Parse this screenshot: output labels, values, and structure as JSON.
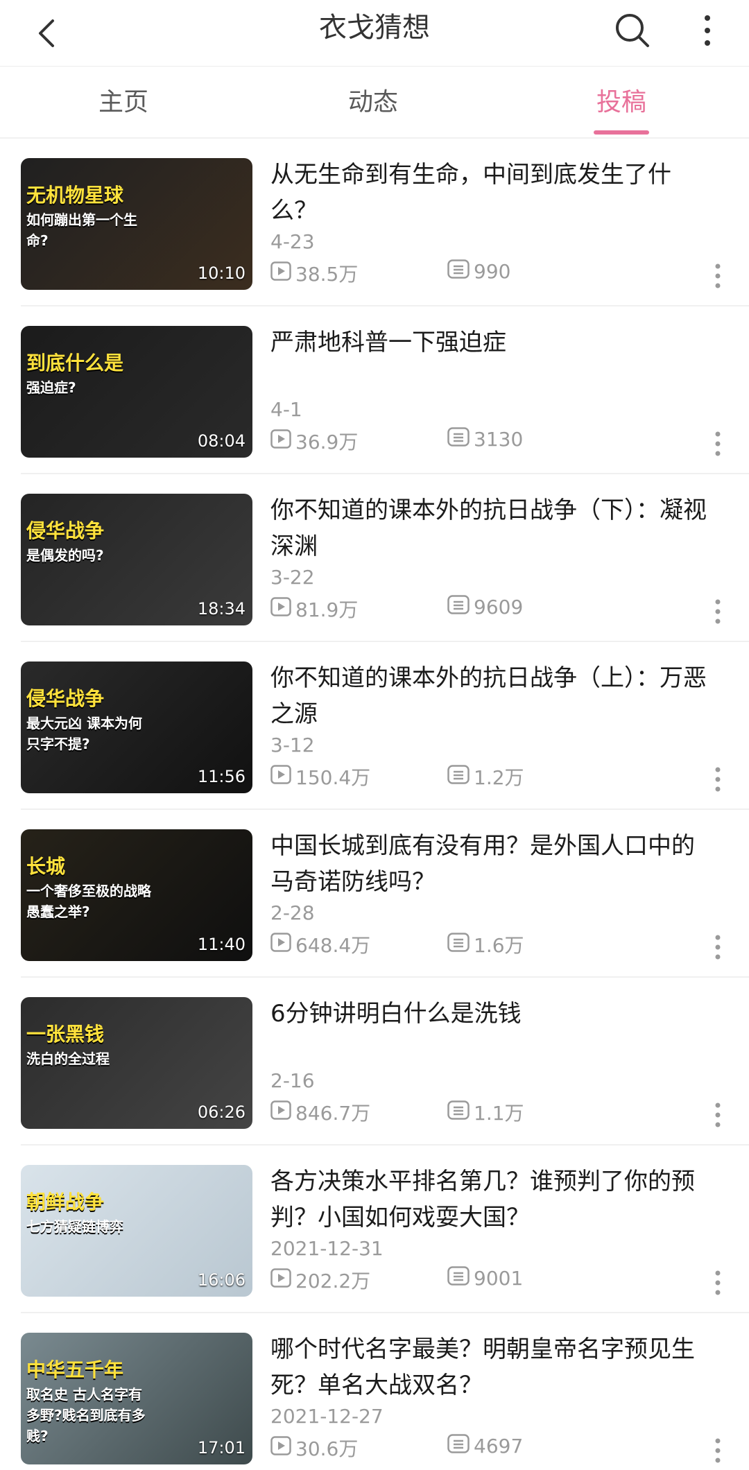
{
  "header": {
    "title": "衣戈猜想"
  },
  "tabs": [
    {
      "label": "主页"
    },
    {
      "label": "动态"
    },
    {
      "label": "投稿"
    }
  ],
  "videos": [
    {
      "title": "从无生命到有生命，中间到底发生了什么？",
      "date": "4-23",
      "plays": "38.5万",
      "comments": "990",
      "duration": "10:10",
      "thumb_text": "无机物星球",
      "thumb_sub": "如何蹦出第一个生命?"
    },
    {
      "title": "严肃地科普一下强迫症",
      "date": "4-1",
      "plays": "36.9万",
      "comments": "3130",
      "duration": "08:04",
      "thumb_text": "到底什么是",
      "thumb_sub": "强迫症?"
    },
    {
      "title": "你不知道的课本外的抗日战争（下）：凝视深渊",
      "date": "3-22",
      "plays": "81.9万",
      "comments": "9609",
      "duration": "18:34",
      "thumb_text": "侵华战争",
      "thumb_sub": "是偶发的吗?"
    },
    {
      "title": "你不知道的课本外的抗日战争（上）：万恶之源",
      "date": "3-12",
      "plays": "150.4万",
      "comments": "1.2万",
      "duration": "11:56",
      "thumb_text": "侵华战争",
      "thumb_sub": "最大元凶 课本为何只字不提?"
    },
    {
      "title": "中国长城到底有没有用？是外国人口中的马奇诺防线吗？",
      "date": "2-28",
      "plays": "648.4万",
      "comments": "1.6万",
      "duration": "11:40",
      "thumb_text": "长城",
      "thumb_sub": "一个奢侈至极的战略愚蠢之举?"
    },
    {
      "title": "6分钟讲明白什么是洗钱",
      "date": "2-16",
      "plays": "846.7万",
      "comments": "1.1万",
      "duration": "06:26",
      "thumb_text": "一张黑钱",
      "thumb_sub": "洗白的全过程"
    },
    {
      "title": "各方决策水平排名第几？谁预判了你的预判？小国如何戏耍大国？",
      "date": "2021-12-31",
      "plays": "202.2万",
      "comments": "9001",
      "duration": "16:06",
      "thumb_text": "朝鲜战争",
      "thumb_sub": "七方猜疑链博弈"
    },
    {
      "title": "哪个时代名字最美？明朝皇帝名字预见生死？单名大战双名？",
      "date": "2021-12-27",
      "plays": "30.6万",
      "comments": "4697",
      "duration": "17:01",
      "thumb_text": "中华五千年",
      "thumb_sub": "取名史 古人名字有多野?贱名到底有多贱?"
    }
  ],
  "colors": {
    "accent": "#e8719a",
    "meta": "#9a9a9a"
  }
}
